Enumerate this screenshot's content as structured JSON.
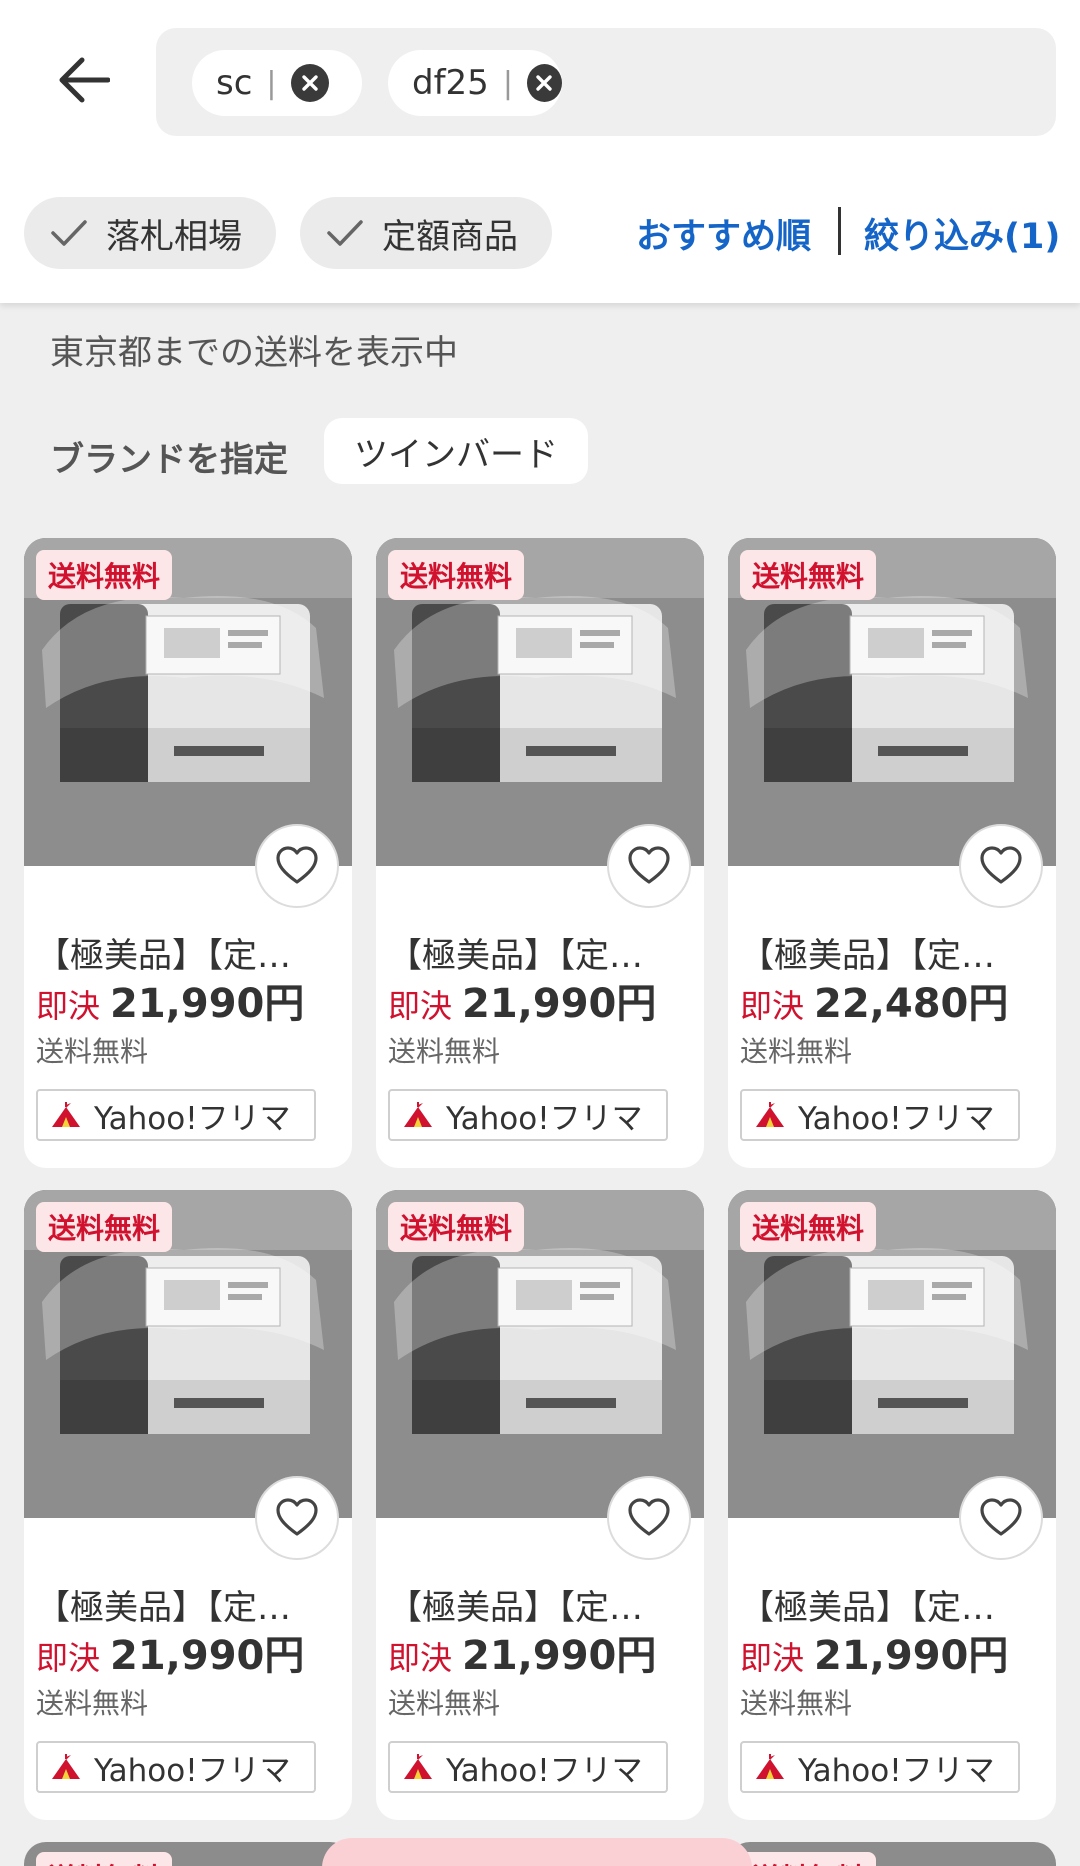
{
  "search": {
    "tags": [
      {
        "text": "sc"
      },
      {
        "text": "df25"
      }
    ],
    "separator": "|"
  },
  "filters": {
    "pills": [
      {
        "label": "落札相場"
      },
      {
        "label": "定額商品"
      }
    ],
    "sort_label": "おすすめ順",
    "refine_label": "絞り込み(1)"
  },
  "info": {
    "shipping_text": "東京都までの送料を表示中",
    "brand_label": "ブランドを指定",
    "brand_value": "ツインバード"
  },
  "products": [
    {
      "badge": "送料無料",
      "title": "【極美品】【定…",
      "price_kind": "即決",
      "price": "21,990円",
      "shipping": "送料無料",
      "source": "Yahoo!フリマ"
    },
    {
      "badge": "送料無料",
      "title": "【極美品】【定…",
      "price_kind": "即決",
      "price": "21,990円",
      "shipping": "送料無料",
      "source": "Yahoo!フリマ"
    },
    {
      "badge": "送料無料",
      "title": "【極美品】【定…",
      "price_kind": "即決",
      "price": "22,480円",
      "shipping": "送料無料",
      "source": "Yahoo!フリマ"
    },
    {
      "badge": "送料無料",
      "title": "【極美品】【定…",
      "price_kind": "即決",
      "price": "21,990円",
      "shipping": "送料無料",
      "source": "Yahoo!フリマ"
    },
    {
      "badge": "送料無料",
      "title": "【極美品】【定…",
      "price_kind": "即決",
      "price": "21,990円",
      "shipping": "送料無料",
      "source": "Yahoo!フリマ"
    },
    {
      "badge": "送料無料",
      "title": "【極美品】【定…",
      "price_kind": "即決",
      "price": "21,990円",
      "shipping": "送料無料",
      "source": "Yahoo!フリマ"
    }
  ],
  "peek": {
    "badge": "送料無料"
  },
  "colors": {
    "accent_blue": "#1565c8",
    "price_red": "#d0122f",
    "badge_bg": "#fde6e8"
  }
}
